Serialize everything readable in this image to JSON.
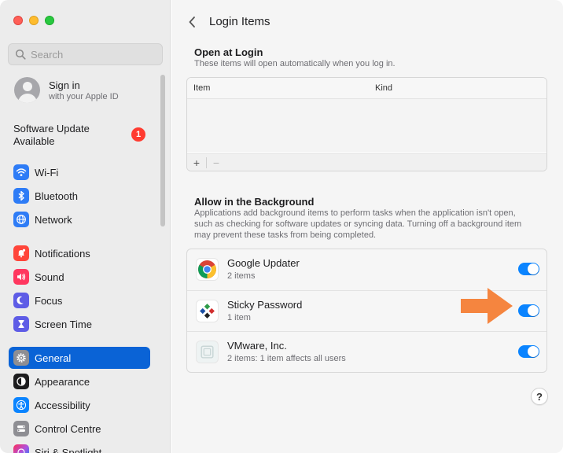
{
  "window": {
    "traffic_lights": [
      "close-icon",
      "minimize-icon",
      "maximize-icon"
    ]
  },
  "sidebar": {
    "search": {
      "placeholder": "Search",
      "value": ""
    },
    "signin": {
      "title": "Sign in",
      "subtitle": "with your Apple ID"
    },
    "software_update": {
      "label": "Software Update Available",
      "badge": "1"
    },
    "items": [
      {
        "label": "Wi-Fi",
        "icon": "wifi-icon",
        "color": "#2e7cf6"
      },
      {
        "label": "Bluetooth",
        "icon": "bluetooth-icon",
        "color": "#2e7cf6"
      },
      {
        "label": "Network",
        "icon": "globe-icon",
        "color": "#2e7cf6"
      },
      {
        "label": "Notifications",
        "icon": "bell-icon",
        "color": "#ff453a"
      },
      {
        "label": "Sound",
        "icon": "speaker-icon",
        "color": "#ff375f"
      },
      {
        "label": "Focus",
        "icon": "moon-icon",
        "color": "#5e5ce6"
      },
      {
        "label": "Screen Time",
        "icon": "hourglass-icon",
        "color": "#5e5ce6"
      },
      {
        "label": "General",
        "icon": "gear-icon",
        "color": "#8e8e93",
        "active": true
      },
      {
        "label": "Appearance",
        "icon": "appearance-icon",
        "color": "#1c1c1e"
      },
      {
        "label": "Accessibility",
        "icon": "accessibility-icon",
        "color": "#0a84ff"
      },
      {
        "label": "Control Centre",
        "icon": "control-centre-icon",
        "color": "#8e8e93"
      },
      {
        "label": "Siri & Spotlight",
        "icon": "siri-icon",
        "color": "#af52de"
      }
    ]
  },
  "main": {
    "title": "Login Items",
    "open_at_login": {
      "title": "Open at Login",
      "description": "These items will open automatically when you log in.",
      "columns": [
        "Item",
        "Kind"
      ],
      "add_label": "+",
      "remove_label": "−"
    },
    "background": {
      "title": "Allow in the Background",
      "description": "Applications add background items to perform tasks when the application isn't open, such as checking for software updates or syncing data. Turning off a background item may prevent these tasks from being completed.",
      "items": [
        {
          "name": "Google Updater",
          "sub": "2 items",
          "icon": "google-chrome-icon",
          "enabled": true
        },
        {
          "name": "Sticky Password",
          "sub": "1 item",
          "icon": "sticky-password-icon",
          "enabled": true
        },
        {
          "name": "VMware, Inc.",
          "sub": "2 items: 1 item affects all users",
          "icon": "vmware-icon",
          "enabled": true
        }
      ]
    },
    "help_label": "?",
    "accent_color": "#0a84ff",
    "arrow_color": "#f5853f"
  }
}
